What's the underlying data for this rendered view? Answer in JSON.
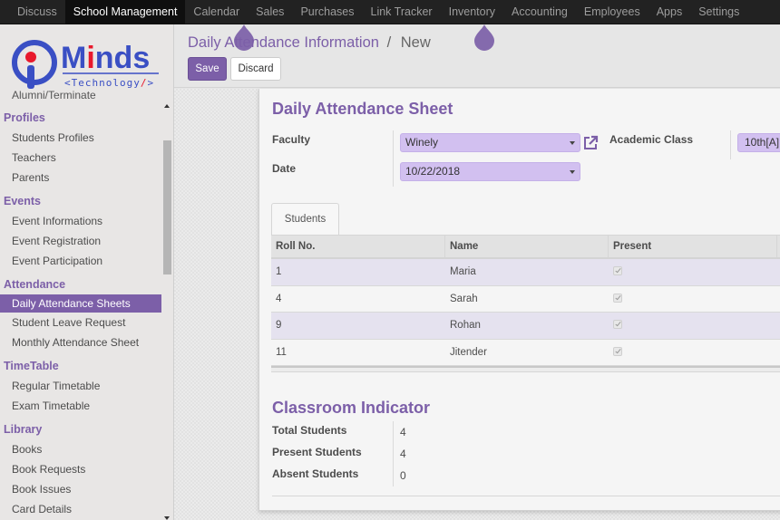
{
  "topnav": {
    "items": [
      "Discuss",
      "School Management",
      "Calendar",
      "Sales",
      "Purchases",
      "Link Tracker",
      "Inventory",
      "Accounting",
      "Employees",
      "Apps",
      "Settings"
    ],
    "active_index": 1
  },
  "logo": {
    "brand": "Minds",
    "tagline": "<Technology/>"
  },
  "sidebar": {
    "clipped_item": "Alumni/Terminate",
    "sections": [
      {
        "title": "Profiles",
        "items": [
          "Students Profiles",
          "Teachers",
          "Parents"
        ]
      },
      {
        "title": "Events",
        "items": [
          "Event Informations",
          "Event Registration",
          "Event Participation"
        ]
      },
      {
        "title": "Attendance",
        "items": [
          "Daily Attendance Sheets",
          "Student Leave Request",
          "Monthly Attendance Sheet"
        ]
      },
      {
        "title": "TimeTable",
        "items": [
          "Regular Timetable",
          "Exam Timetable"
        ]
      },
      {
        "title": "Library",
        "items": [
          "Books",
          "Book Requests",
          "Book Issues",
          "Card Details"
        ]
      }
    ],
    "active_item": "Daily Attendance Sheets"
  },
  "breadcrumb": {
    "parent": "Daily Attendance Information",
    "separator": "/",
    "current": "New"
  },
  "buttons": {
    "save": "Save",
    "discard": "Discard"
  },
  "form": {
    "title": "Daily Attendance Sheet",
    "faculty_label": "Faculty",
    "faculty_value": "Winely",
    "date_label": "Date",
    "date_value": "10/22/2018",
    "academic_class_label": "Academic Class",
    "academic_class_value": "10th[A]"
  },
  "tabs": [
    {
      "label": "Students",
      "active": true
    }
  ],
  "students_table": {
    "columns": [
      "Roll No.",
      "Name",
      "Present"
    ],
    "rows": [
      {
        "roll": "1",
        "name": "Maria",
        "present": true
      },
      {
        "roll": "4",
        "name": "Sarah",
        "present": true
      },
      {
        "roll": "9",
        "name": "Rohan",
        "present": true
      },
      {
        "roll": "11",
        "name": "Jitender",
        "present": true
      }
    ]
  },
  "classroom_indicator": {
    "title": "Classroom Indicator",
    "total_label": "Total Students",
    "total_value": "4",
    "present_label": "Present Students",
    "present_value": "4",
    "absent_label": "Absent Students",
    "absent_value": "0"
  },
  "colors": {
    "accent": "#7c5fa8",
    "field_bg": "#d2c0f0",
    "navbar_bg": "#222222"
  }
}
